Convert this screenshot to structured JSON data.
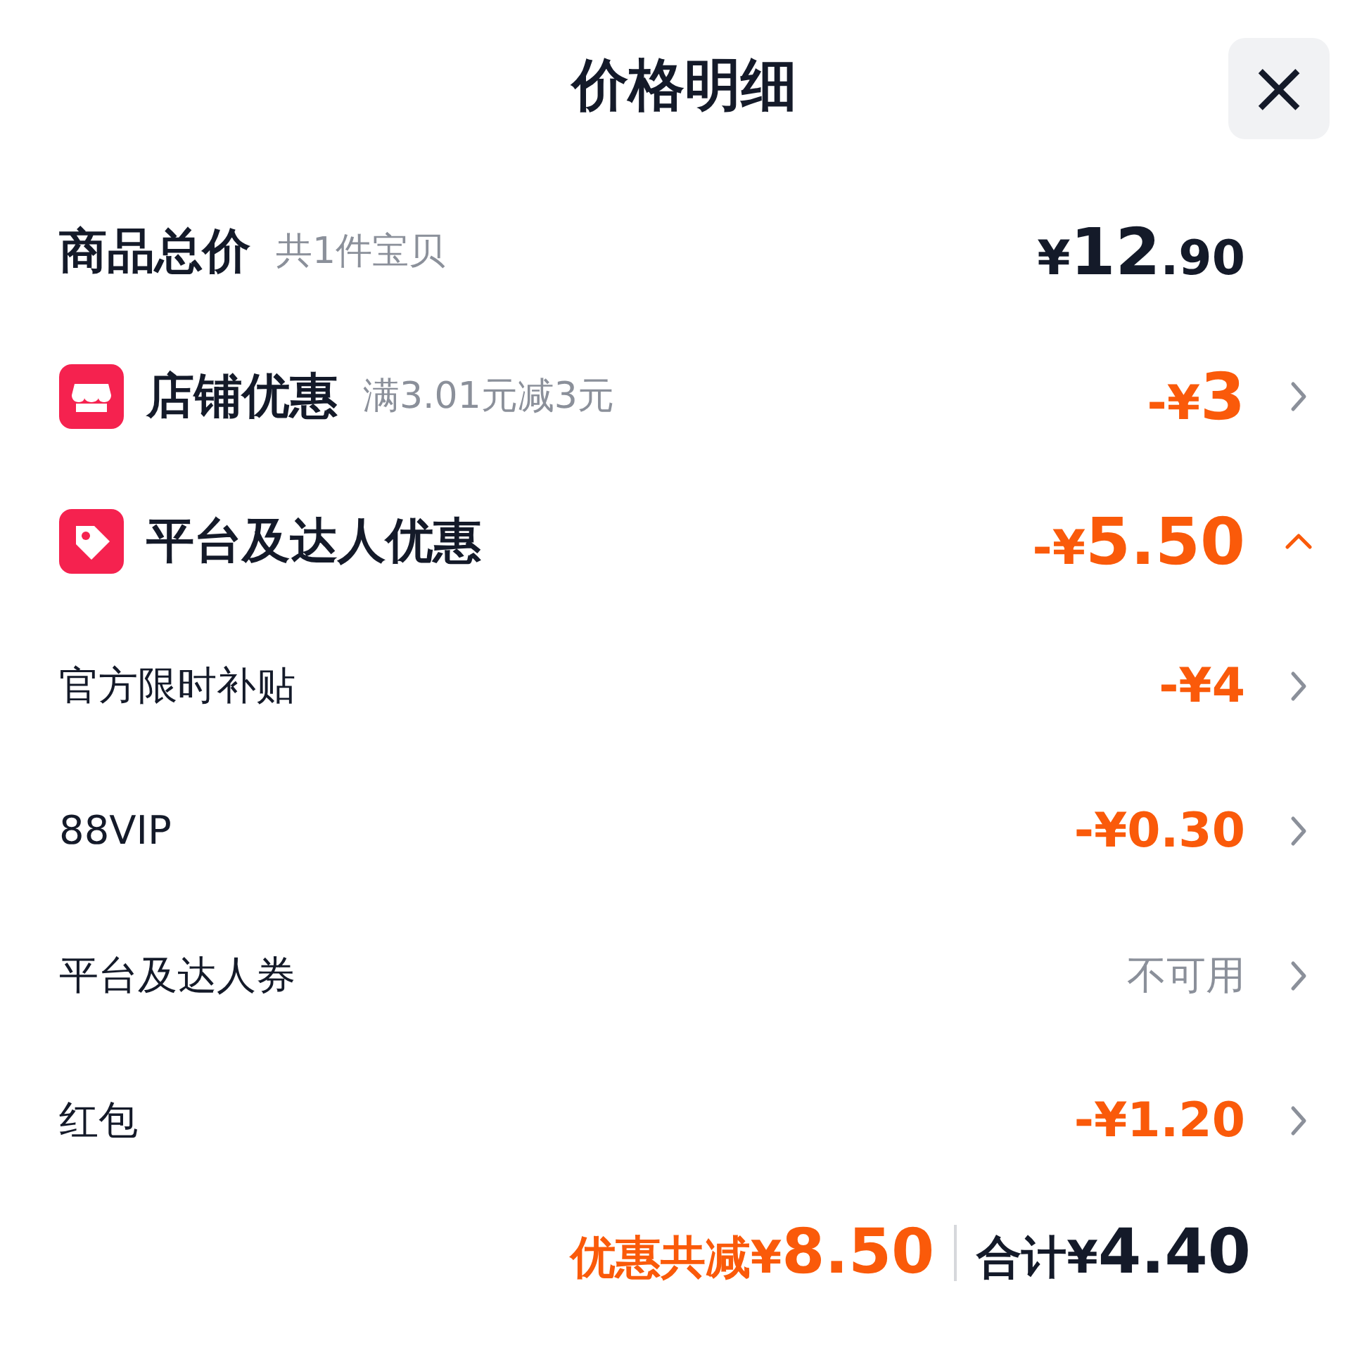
{
  "title": "价格明细",
  "close_button": "×",
  "rows": [
    {
      "kind": "total",
      "label": "商品总价",
      "note": "共1件宝贝",
      "price_symbol": "¥",
      "price_whole": "12",
      "price_decimal": ".90"
    },
    {
      "kind": "shop_discount",
      "label": "店铺优惠",
      "note": "满3.01元减3元",
      "price_sign": "-¥",
      "price_amount": "3",
      "expanded": false
    },
    {
      "kind": "platform_discount",
      "label": "平台及达人优惠",
      "price_sign": "-¥",
      "price_amount": "5.50",
      "expanded": true
    },
    {
      "kind": "deduction",
      "label": "官方限时补贴",
      "price": "-¥4",
      "expanded": false
    },
    {
      "kind": "deduction",
      "label": "88VIP",
      "price": "-¥0.30",
      "expanded": false
    },
    {
      "kind": "unavailable",
      "label": "平台及达人券",
      "status": "不可用",
      "expanded": false
    },
    {
      "kind": "deduction",
      "label": "红包",
      "price": "-¥1.20",
      "expanded": false
    }
  ],
  "footer": {
    "discount_label": "优惠共减¥",
    "discount_value": "8.50",
    "total_label": "合计¥",
    "total_value": "4.40"
  }
}
